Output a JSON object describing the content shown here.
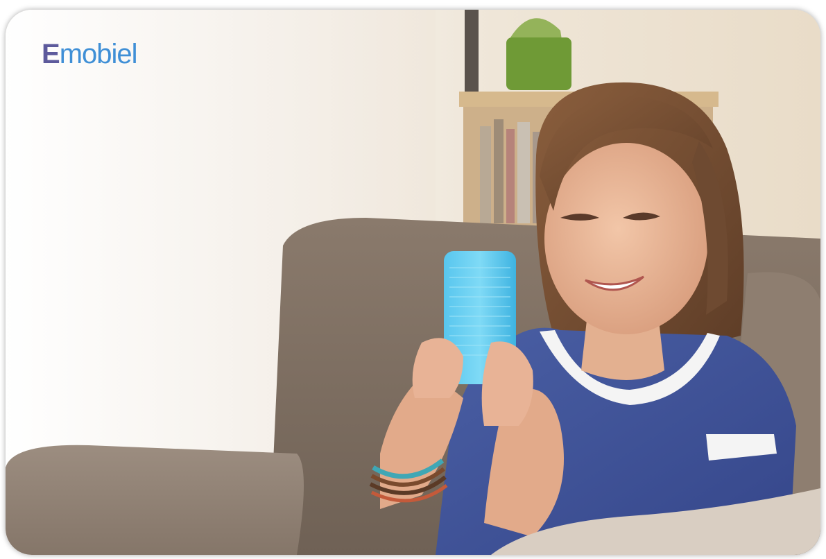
{
  "brand": {
    "initial": "E",
    "rest": "mobiel",
    "initial_color": "#5d5a9c",
    "rest_color": "#3f8fd6"
  },
  "photo": {
    "subject": "smiling-woman-using-phone-icon"
  }
}
